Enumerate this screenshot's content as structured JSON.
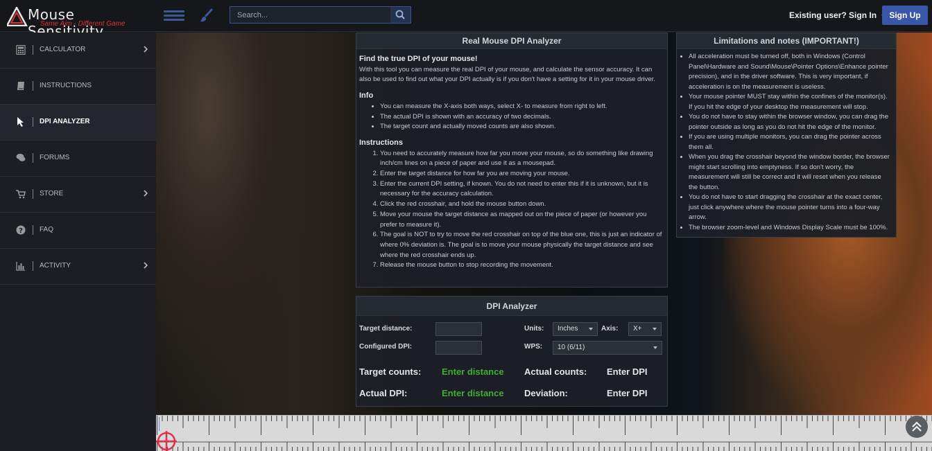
{
  "header": {
    "logo_title": "Mouse Sensitivity",
    "logo_subtitle": "Same Aim - Different Game",
    "search_placeholder": "Search...",
    "signin_label": "Existing user? Sign In",
    "signup_label": "Sign Up"
  },
  "sidebar": {
    "items": [
      {
        "label": "CALCULATOR",
        "icon": "calculator-icon",
        "has_chevron": true
      },
      {
        "label": "INSTRUCTIONS",
        "icon": "book-icon",
        "has_chevron": false
      },
      {
        "label": "DPI ANALYZER",
        "icon": "cursor-icon",
        "has_chevron": false,
        "active": true
      },
      {
        "label": "FORUMS",
        "icon": "comments-icon",
        "has_chevron": false
      },
      {
        "label": "STORE",
        "icon": "cart-icon",
        "has_chevron": true
      },
      {
        "label": "FAQ",
        "icon": "question-icon",
        "has_chevron": false
      },
      {
        "label": "ACTIVITY",
        "icon": "bar-chart-icon",
        "has_chevron": true
      }
    ]
  },
  "analyzer": {
    "title": "Real Mouse DPI Analyzer",
    "intro_heading": "Find the true DPI of your mouse!",
    "intro_text": "With this tool you can measure the real DPI of your mouse, and calculate the sensor accuracy. It can also be used to find out what your DPI actually is if you don't have a setting for it in your mouse driver.",
    "info_heading": "Info",
    "info_items": [
      "You can measure the X-axis both ways, select X- to measure from right to left.",
      "The actual DPI is shown with an accuracy of two decimals.",
      "The target count and actually moved counts are also shown."
    ],
    "instructions_heading": "Instructions",
    "instruction_items": [
      "You need to accurately measure how far you move your mouse, so do something like drawing inch/cm lines on a piece of paper and use it as a mousepad.",
      "Enter the target distance for how far you are moving your mouse.",
      "Enter the current DPI setting, if known. You do not need to enter this if it is unknown, but it is necessary for the accuracy calculation.",
      "Click the red crosshair, and hold the mouse button down.",
      "Move your mouse the target distance as mapped out on the piece of paper (or however you prefer to measure it).",
      "The goal is NOT to try to move the red crosshair on top of the blue one, this is just an indicator of where 0% deviation is. The goal is to move your mouse physically the target distance and see where the red crosshair ends up.",
      "Release the mouse button to stop recording the movement."
    ]
  },
  "limits": {
    "title": "Limitations and notes (IMPORTANT!)",
    "items": [
      "All acceleration must be turned off, both in Windows (Control Panel\\Hardware and Sound\\Mouse\\Pointer Options\\Enhance pointer precision), and in the driver software. This is very important, if acceleration is on the measurement is useless.",
      "Your mouse pointer MUST stay within the confines of the monitor(s). If you hit the edge of your desktop the measurement will stop.",
      "You do not have to stay within the browser window, you can drag the pointer outside as long as you do not hit the edge of the monitor.",
      "If you are using multiple monitors, you can drag the pointer across them all.",
      "When you drag the crosshair beyond the window border, the browser might start scrolling into emptyness. If so don't worry, the measurement will still be correct and it will reset when you release the button.",
      "You do not have to start dragging the crosshair at the exact center, just click anywhere where the mouse pointer turns into a four-way arrow.",
      "The browser zoom-level and Windows Display Scale must be 100%."
    ]
  },
  "dpi_analyzer": {
    "title": "DPI Analyzer",
    "target_distance_label": "Target distance:",
    "configured_dpi_label": "Configured DPI:",
    "units_label": "Units:",
    "units_value": "Inches",
    "axis_label": "Axis:",
    "axis_value": "X+",
    "wps_label": "WPS:",
    "wps_value": "10 (6/11)",
    "target_counts_label": "Target counts:",
    "target_counts_value": "Enter distance",
    "actual_counts_label": "Actual counts:",
    "actual_counts_value": "Enter DPI",
    "actual_dpi_label": "Actual DPI:",
    "actual_dpi_value": "Enter distance",
    "deviation_label": "Deviation:",
    "deviation_value": "Enter DPI"
  },
  "colors": {
    "accent": "#3a56a8",
    "green": "#3fae36",
    "crosshair": "#e0304a"
  }
}
